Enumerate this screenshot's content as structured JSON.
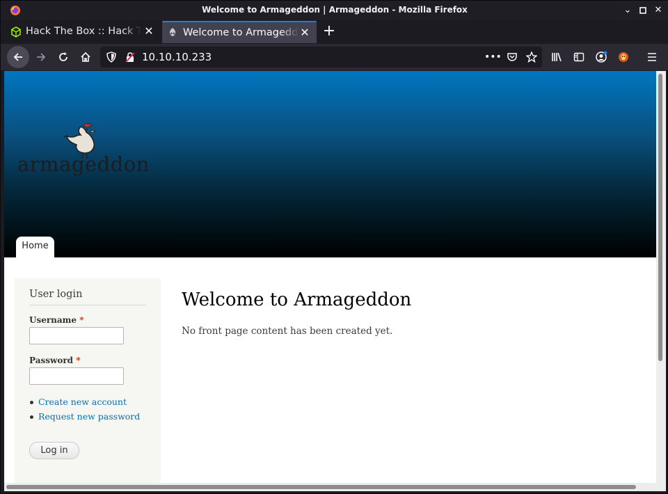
{
  "window": {
    "title": "Welcome to Armageddon | Armageddon - Mozilla Firefox"
  },
  "tabs": [
    {
      "title": "Hack The Box :: Hack The Box",
      "active": false,
      "icon": "htb-cube-icon"
    },
    {
      "title": "Welcome to Armageddon | Armageddon",
      "active": true,
      "icon": "drupal-icon"
    }
  ],
  "navbar": {
    "url": "10.10.10.233"
  },
  "site": {
    "logo_text": "armageddon",
    "nav": {
      "home": "Home"
    },
    "login_block": {
      "title": "User login",
      "username_label": "Username",
      "password_label": "Password",
      "required_mark": "*",
      "links": [
        "Create new account",
        "Request new password"
      ],
      "submit": "Log in"
    },
    "main": {
      "title": "Welcome to Armageddon",
      "text": "No front page content has been created yet."
    }
  },
  "colors": {
    "accent": "#0a84ff",
    "link": "#0071b3",
    "header_top": "#0077c0",
    "header_bottom": "#000000"
  }
}
